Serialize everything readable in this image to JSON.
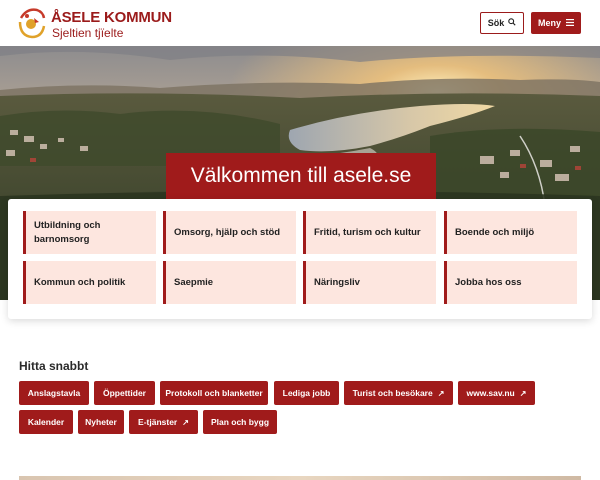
{
  "header": {
    "brand_title": "ÅSELE KOMMUN",
    "brand_subtitle": "Sjeltien tjïelte",
    "search_label": "Sök",
    "menu_label": "Meny",
    "accent_color": "#a01b1b"
  },
  "hero": {
    "welcome": "Välkommen till asele.se"
  },
  "categories": [
    {
      "label": "Utbildning och barnomsorg"
    },
    {
      "label": "Omsorg, hjälp och stöd"
    },
    {
      "label": "Fritid, turism och kultur"
    },
    {
      "label": "Boende och miljö"
    },
    {
      "label": "Kommun och politik"
    },
    {
      "label": "Saepmie"
    },
    {
      "label": "Näringsliv"
    },
    {
      "label": "Jobba hos oss"
    }
  ],
  "quick": {
    "title": "Hitta snabbt",
    "links": [
      {
        "label": "Anslagstavla",
        "external": false
      },
      {
        "label": "Öppettider",
        "external": false
      },
      {
        "label": "Protokoll och blanketter",
        "external": false
      },
      {
        "label": "Lediga jobb",
        "external": false
      },
      {
        "label": "Turist och besökare",
        "external": true
      },
      {
        "label": "www.sav.nu",
        "external": true
      },
      {
        "label": "Kalender",
        "external": false
      },
      {
        "label": "Nyheter",
        "external": false
      },
      {
        "label": "E-tjänster",
        "external": true
      },
      {
        "label": "Plan och bygg",
        "external": false
      }
    ]
  }
}
